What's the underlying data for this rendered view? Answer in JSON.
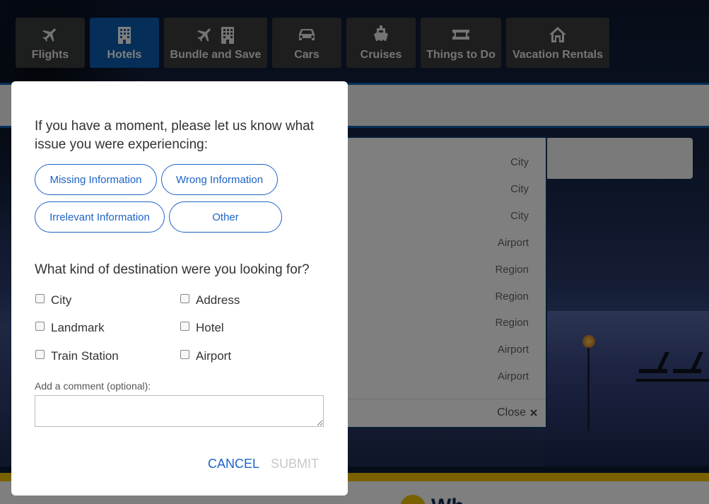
{
  "tabs": [
    {
      "label": "Flights",
      "icon": "plane-icon",
      "active": false
    },
    {
      "label": "Hotels",
      "icon": "building-icon",
      "active": true
    },
    {
      "label": "Bundle and Save",
      "icon": "plane-building-icon",
      "active": false
    },
    {
      "label": "Cars",
      "icon": "car-icon",
      "active": false
    },
    {
      "label": "Cruises",
      "icon": "ship-icon",
      "active": false
    },
    {
      "label": "Things to Do",
      "icon": "ticket-icon",
      "active": false
    },
    {
      "label": "Vacation Rentals",
      "icon": "house-icon",
      "active": false
    }
  ],
  "dropdown": {
    "items": [
      "City",
      "City",
      "City",
      "Airport",
      "Region",
      "Region",
      "Region",
      "Airport",
      "Airport"
    ],
    "close_label": "Close"
  },
  "modal": {
    "question_issue": "If you have a moment, please let us know what issue you were experiencing:",
    "issue_options": [
      "Missing Information",
      "Wrong Information",
      "Irrelevant Information",
      "Other"
    ],
    "question_destination": "What kind of destination were you looking for?",
    "destination_options": [
      "City",
      "Address",
      "Landmark",
      "Hotel",
      "Train Station",
      "Airport"
    ],
    "comment_label": "Add a comment (optional):",
    "comment_value": "",
    "cancel_label": "CANCEL",
    "submit_label": "SUBMIT"
  },
  "bottom": {
    "heading_partial": "Wh"
  },
  "colors": {
    "accent": "#1d63c7",
    "active_tab": "#0b5fb0",
    "brand_yellow": "#f3c300"
  }
}
